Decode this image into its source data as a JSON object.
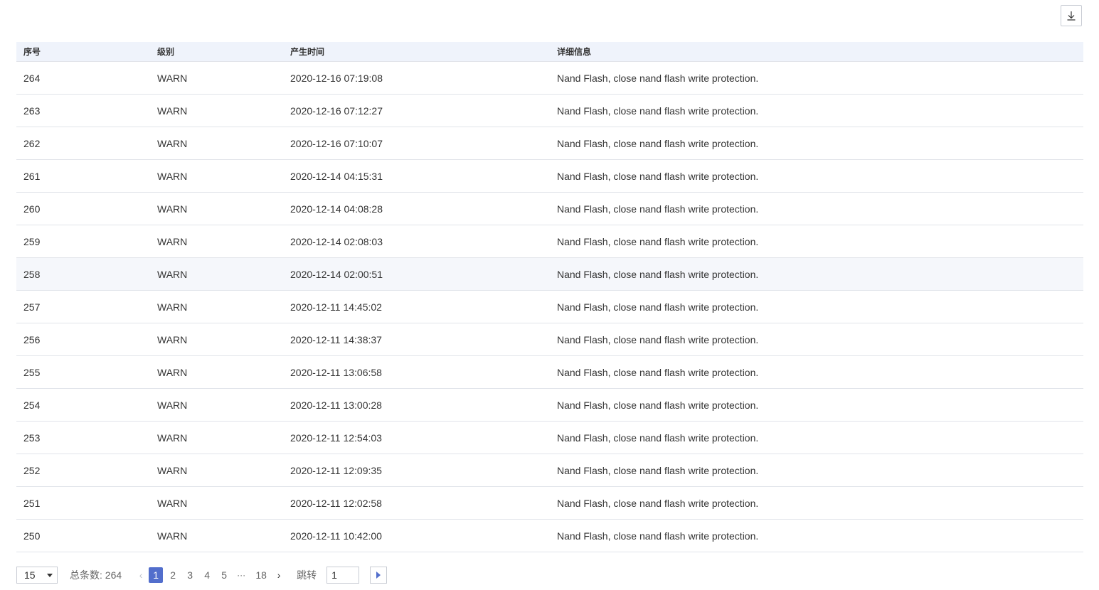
{
  "toolbar": {
    "download_icon": "download-icon"
  },
  "table": {
    "columns": [
      "序号",
      "级别",
      "产生时间",
      "详细信息"
    ],
    "rows": [
      {
        "id": "264",
        "level": "WARN",
        "time": "2020-12-16 07:19:08",
        "detail": "Nand Flash, close nand flash write protection."
      },
      {
        "id": "263",
        "level": "WARN",
        "time": "2020-12-16 07:12:27",
        "detail": "Nand Flash, close nand flash write protection."
      },
      {
        "id": "262",
        "level": "WARN",
        "time": "2020-12-16 07:10:07",
        "detail": "Nand Flash, close nand flash write protection."
      },
      {
        "id": "261",
        "level": "WARN",
        "time": "2020-12-14 04:15:31",
        "detail": "Nand Flash, close nand flash write protection."
      },
      {
        "id": "260",
        "level": "WARN",
        "time": "2020-12-14 04:08:28",
        "detail": "Nand Flash, close nand flash write protection."
      },
      {
        "id": "259",
        "level": "WARN",
        "time": "2020-12-14 02:08:03",
        "detail": "Nand Flash, close nand flash write protection."
      },
      {
        "id": "258",
        "level": "WARN",
        "time": "2020-12-14 02:00:51",
        "detail": "Nand Flash, close nand flash write protection."
      },
      {
        "id": "257",
        "level": "WARN",
        "time": "2020-12-11 14:45:02",
        "detail": "Nand Flash, close nand flash write protection."
      },
      {
        "id": "256",
        "level": "WARN",
        "time": "2020-12-11 14:38:37",
        "detail": "Nand Flash, close nand flash write protection."
      },
      {
        "id": "255",
        "level": "WARN",
        "time": "2020-12-11 13:06:58",
        "detail": "Nand Flash, close nand flash write protection."
      },
      {
        "id": "254",
        "level": "WARN",
        "time": "2020-12-11 13:00:28",
        "detail": "Nand Flash, close nand flash write protection."
      },
      {
        "id": "253",
        "level": "WARN",
        "time": "2020-12-11 12:54:03",
        "detail": "Nand Flash, close nand flash write protection."
      },
      {
        "id": "252",
        "level": "WARN",
        "time": "2020-12-11 12:09:35",
        "detail": "Nand Flash, close nand flash write protection."
      },
      {
        "id": "251",
        "level": "WARN",
        "time": "2020-12-11 12:02:58",
        "detail": "Nand Flash, close nand flash write protection."
      },
      {
        "id": "250",
        "level": "WARN",
        "time": "2020-12-11 10:42:00",
        "detail": "Nand Flash, close nand flash write protection."
      }
    ],
    "highlighted_row": 6
  },
  "pagination": {
    "page_size": "15",
    "total_label": "总条数: 264",
    "pages": [
      "1",
      "2",
      "3",
      "4",
      "5"
    ],
    "active_page": "1",
    "ellipsis": "···",
    "last_page": "18",
    "jump_label": "跳转",
    "jump_value": "1",
    "prev_icon": "chevron-left-icon",
    "next_icon": "chevron-right-icon",
    "go_icon": "play-icon"
  },
  "colors": {
    "header_bg": "#eff3fb",
    "accent": "#526ecc",
    "row_highlight": "#f5f7fb",
    "border": "#e1e4ea"
  }
}
